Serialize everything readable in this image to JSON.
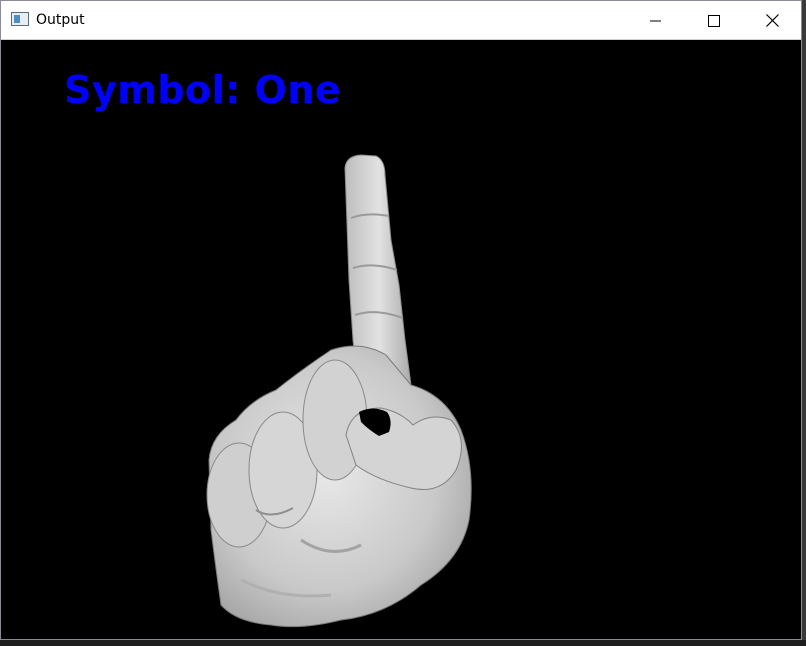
{
  "window": {
    "title": "Output",
    "icon": "app-window-icon",
    "controls": {
      "minimize_icon": "minimize-icon",
      "maximize_icon": "maximize-icon",
      "close_icon": "close-icon"
    }
  },
  "canvas": {
    "background": "#000000",
    "overlay_text": "Symbol: One",
    "overlay_color": "#0000ff",
    "image": "grayscale-hand-index-finger-up"
  }
}
